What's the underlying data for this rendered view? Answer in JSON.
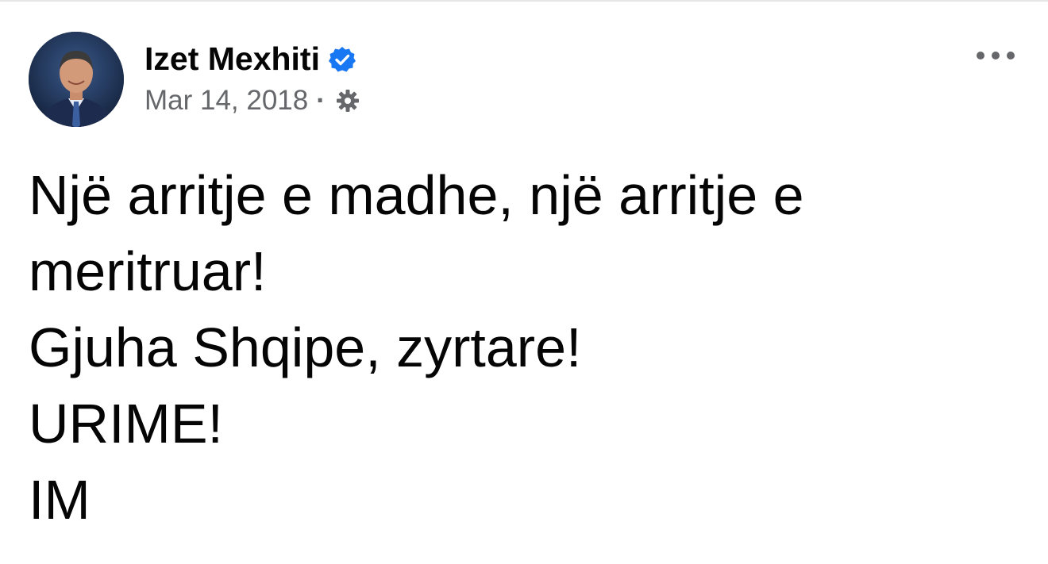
{
  "post": {
    "author": {
      "name": "Izet Mexhiti",
      "verified": true,
      "avatar_icon": "person-portrait-icon"
    },
    "timestamp": "Mar 14, 2018",
    "separator": "·",
    "privacy_icon": "gear-icon",
    "more_icon": "more-options-icon",
    "lines": [
      "Një arritje e madhe, një arritje e",
      "meritruar!",
      "Gjuha Shqipe, zyrtare!",
      "URIME!",
      "IM"
    ]
  },
  "colors": {
    "text_primary": "#050505",
    "text_secondary": "#65676b",
    "verified_blue": "#1877f2",
    "background": "#ffffff"
  }
}
